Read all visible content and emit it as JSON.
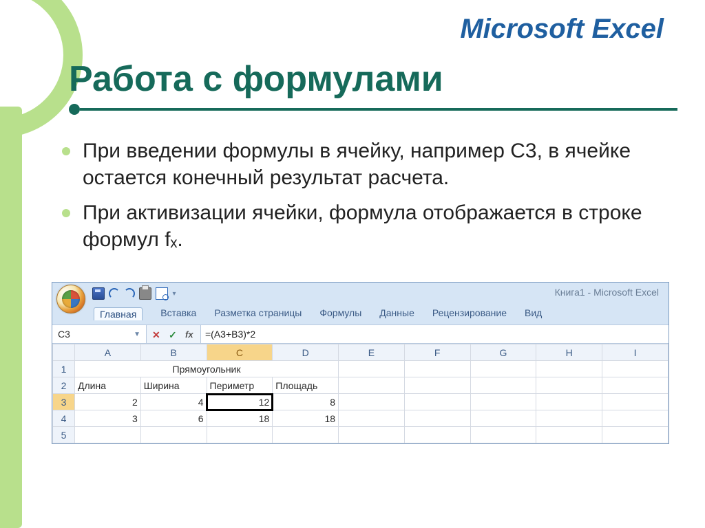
{
  "brand": "Microsoft Excel",
  "title": "Работа с формулами",
  "bullets": [
    "При введении формулы в ячейку, например С3, в ячейке остается конечный результат расчета.",
    "При активизации ячейки, формула отображается в строке формул fₓ."
  ],
  "excel": {
    "book_title": "Книга1 - Microsoft Excel",
    "tabs": [
      "Главная",
      "Вставка",
      "Разметка страницы",
      "Формулы",
      "Данные",
      "Рецензирование",
      "Вид"
    ],
    "active_tab_index": 0,
    "name_box": "C3",
    "formula_bar": "=(A3+B3)*2",
    "columns": [
      "A",
      "B",
      "C",
      "D",
      "E",
      "F",
      "G",
      "H",
      "I"
    ],
    "rows_shown": 5,
    "active_cell": {
      "row": 3,
      "col": "C"
    },
    "merged_header": {
      "row": 1,
      "span_cols": [
        "A",
        "B",
        "C",
        "D"
      ],
      "text": "Прямоугольник"
    },
    "header_row": {
      "row": 2,
      "values": {
        "A": "Длина",
        "B": "Ширина",
        "C": "Периметр",
        "D": "Площадь"
      }
    },
    "data_rows": [
      {
        "row": 3,
        "A": "2",
        "B": "4",
        "C": "12",
        "D": "8"
      },
      {
        "row": 4,
        "A": "3",
        "B": "6",
        "C": "18",
        "D": "18"
      }
    ]
  }
}
